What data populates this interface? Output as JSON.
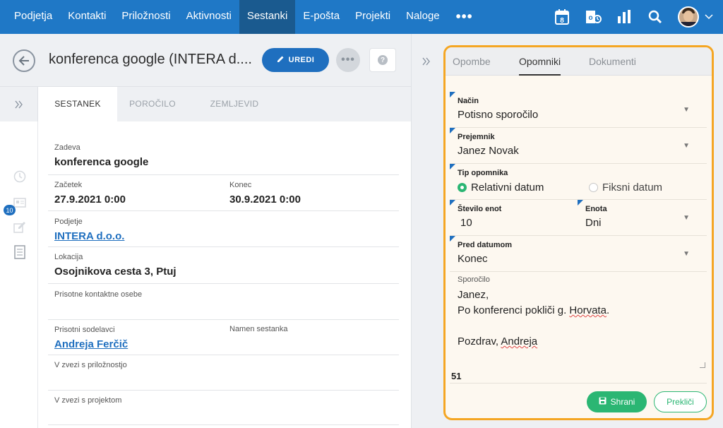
{
  "nav": {
    "items": [
      "Podjetja",
      "Kontakti",
      "Priložnosti",
      "Aktivnosti",
      "Sestanki",
      "E-pošta",
      "Projekti",
      "Naloge"
    ],
    "active": "Sestanki",
    "more": "•••",
    "calendar_day": "8"
  },
  "record": {
    "title": "konferenca google (INTERA d....",
    "edit_label": "UREDI",
    "more_label": "•••",
    "help_label": "?"
  },
  "tabs": [
    "SESTANEK",
    "POROČILO",
    "ZEMLJEVID"
  ],
  "active_tab": "SESTANEK",
  "badge_count": "10",
  "form": {
    "subject_label": "Zadeva",
    "subject": "konferenca google",
    "start_label": "Začetek",
    "start": "27.9.2021 0:00",
    "end_label": "Konec",
    "end": "30.9.2021 0:00",
    "company_label": "Podjetje",
    "company": "INTERA d.o.o.",
    "location_label": "Lokacija",
    "location": "Osojnikova cesta 3, Ptuj",
    "contacts_label": "Prisotne kontaktne osebe",
    "coworkers_label": "Prisotni sodelavci",
    "coworker": "Andreja Ferčič",
    "purpose_label": "Namen sestanka",
    "opportunity_label": "V zvezi s priložnostjo",
    "project_label": "V zvezi s projektom"
  },
  "panel": {
    "tabs": [
      "Opombe",
      "Opomniki",
      "Dokumenti"
    ],
    "active_tab": "Opomniki",
    "method_label": "Način",
    "method": "Potisno sporočilo",
    "recipient_label": "Prejemnik",
    "recipient": "Janez Novak",
    "type_label": "Tip opomnika",
    "type_option1": "Relativni datum",
    "type_option2": "Fiksni datum",
    "type_selected": "Relativni datum",
    "units_count_label": "Število enot",
    "units_count": "10",
    "unit_label": "Enota",
    "unit": "Dni",
    "before_label": "Pred datumom",
    "before": "Konec",
    "message_label": "Sporočilo",
    "message_line1": "Janez,",
    "message_line2_a": "Po konferenci pokliči g. ",
    "message_line2_b": "Horvata",
    "message_line2_c": ".",
    "message_line3_a": "Pozdrav, ",
    "message_line3_b": "Andreja",
    "char_count": "51",
    "save_label": "Shrani",
    "cancel_label": "Prekliči"
  },
  "colors": {
    "nav_bg": "#1f78c6",
    "nav_active": "#1a5a8f",
    "primary": "#1f6fbf",
    "success": "#2bb673",
    "highlight": "#f5a623"
  }
}
